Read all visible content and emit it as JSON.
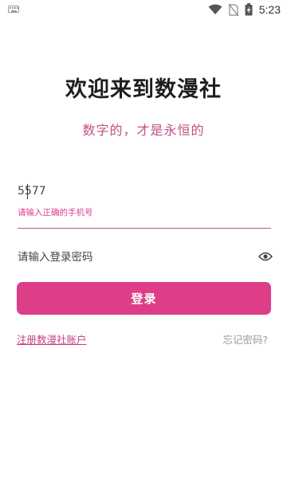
{
  "status_bar": {
    "time": "5:23",
    "icons": [
      "keyboard-icon",
      "wifi-icon",
      "no-sim-icon",
      "battery-charging-icon"
    ]
  },
  "header": {
    "title": "欢迎来到数漫社",
    "subtitle": "数字的，才是永恒的"
  },
  "form": {
    "phone_value": "5577",
    "phone_error": "请输入正确的手机号",
    "password_placeholder": "请输入登录密码",
    "password_toggle_icon": "eye-icon",
    "login_label": "登录"
  },
  "links": {
    "register": "注册数漫社账户",
    "forgot": "忘记密码?"
  },
  "colors": {
    "accent": "#de3e87",
    "subtitle": "#c44e86",
    "link_muted": "#9a9a9a"
  }
}
